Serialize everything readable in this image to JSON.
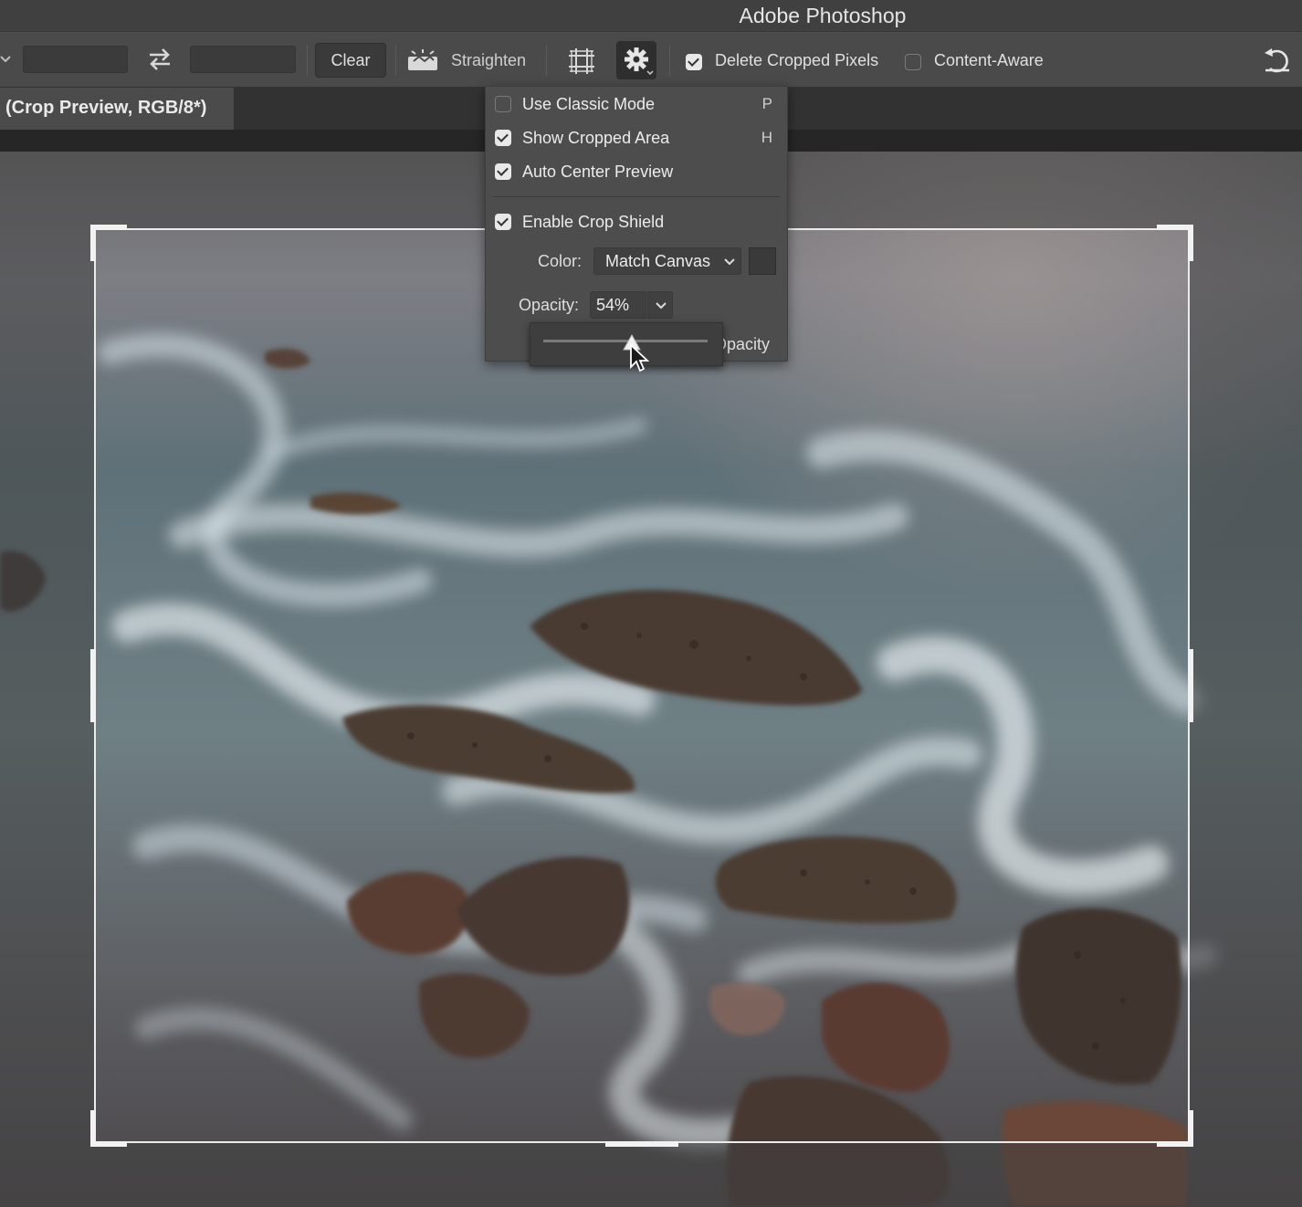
{
  "app": {
    "title": "Adobe Photoshop"
  },
  "toolbar": {
    "clear_label": "Clear",
    "straighten_label": "Straighten",
    "delete_cropped_label": "Delete Cropped Pixels",
    "delete_cropped_checked": true,
    "content_aware_label": "Content-Aware",
    "content_aware_checked": false,
    "icons": [
      "chevron-down-icon",
      "swap-icon",
      "straighten-icon",
      "grid-overlay-icon",
      "gear-icon",
      "reset-icon"
    ]
  },
  "document": {
    "tab_label": "(Crop Preview, RGB/8*)"
  },
  "crop_menu": {
    "items": [
      {
        "label": "Use Classic Mode",
        "shortcut": "P",
        "checked": false
      },
      {
        "label": "Show Cropped Area",
        "shortcut": "H",
        "checked": true
      },
      {
        "label": "Auto Center Preview",
        "shortcut": "",
        "checked": true
      },
      {
        "label": "Enable Crop Shield",
        "shortcut": "",
        "checked": true
      }
    ],
    "color_label": "Color:",
    "color_value": "Match Canvas",
    "opacity_label": "Opacity:",
    "opacity_value": "54%",
    "opacity_slider_fraction": 0.54,
    "opacity_tail_label": "Opacity"
  },
  "colors": {
    "titlebar": "#404040",
    "optionsbar": "#4a4a4a",
    "panel": "#4d4d4d",
    "shield": "#404040"
  }
}
